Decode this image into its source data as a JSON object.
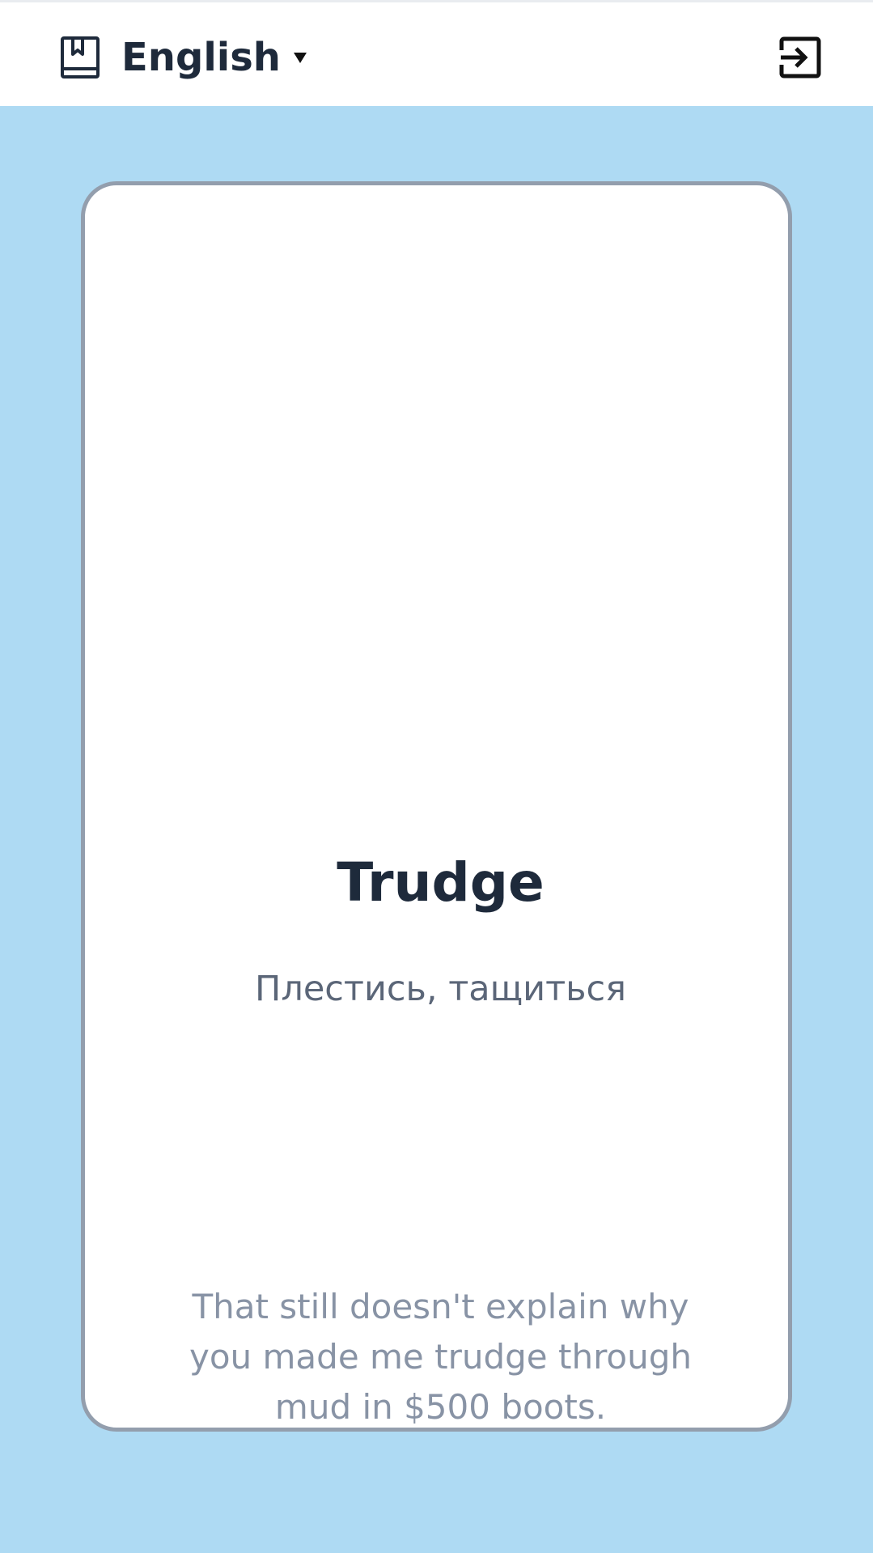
{
  "header": {
    "language_label": "English",
    "icons": {
      "dictionary": "book-bookmark-icon",
      "dropdown": "caret-down-icon",
      "exit": "logout-icon"
    }
  },
  "card": {
    "word": "Trudge",
    "translation": "Плестись, тащиться",
    "example": "That still doesn't explain why you made me trudge through mud in $500 boots."
  },
  "colors": {
    "background": "#aedaf3",
    "card_border": "#939ead",
    "text_primary": "#1e2a3b",
    "text_secondary": "#5b6678",
    "text_muted": "#8893a5"
  }
}
